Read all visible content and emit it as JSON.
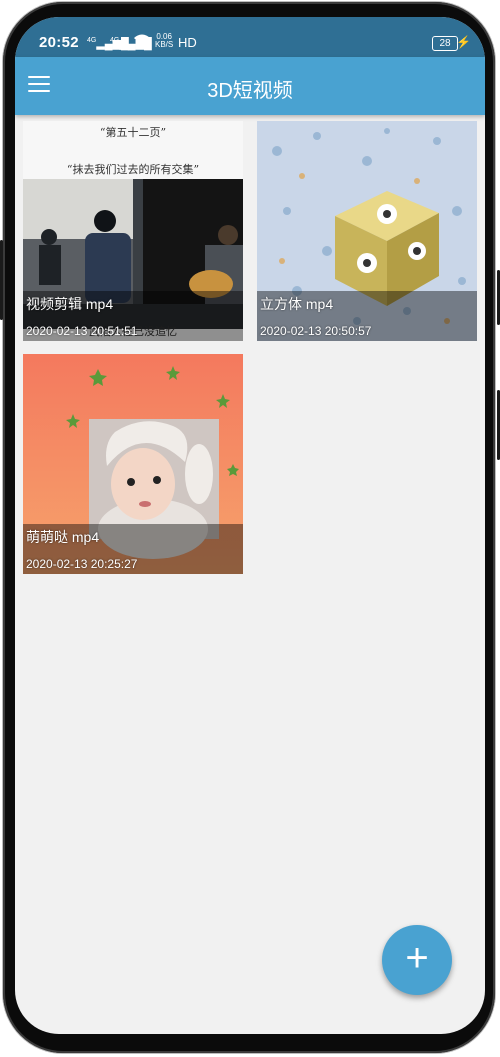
{
  "status_bar": {
    "time": "20:52",
    "signal1": "4G",
    "signal2": "4G",
    "speed_value": "0.06",
    "speed_unit": "KB/S",
    "hd": "HD",
    "battery": "28"
  },
  "app_bar": {
    "title": "3D短视频",
    "menu_icon": "hamburger-menu-icon"
  },
  "videos": [
    {
      "name": "视频剪辑 mp4",
      "time": "2020-02-13 20:51:51",
      "caption_top": "“第五十二页”",
      "caption_mid": "“抹去我们过去的所有交集”",
      "caption_bottom": "武陷入往已没追忆"
    },
    {
      "name": "立方体 mp4",
      "time": "2020-02-13 20:50:57"
    },
    {
      "name": "萌萌哒 mp4",
      "time": "2020-02-13 20:25:27"
    }
  ],
  "fab": {
    "icon": "plus-icon",
    "label": "+"
  },
  "colors": {
    "status_bar": "#2f6f94",
    "app_bar": "#49a2d1",
    "background": "#f1f1f1",
    "fab": "#49a2d1"
  }
}
